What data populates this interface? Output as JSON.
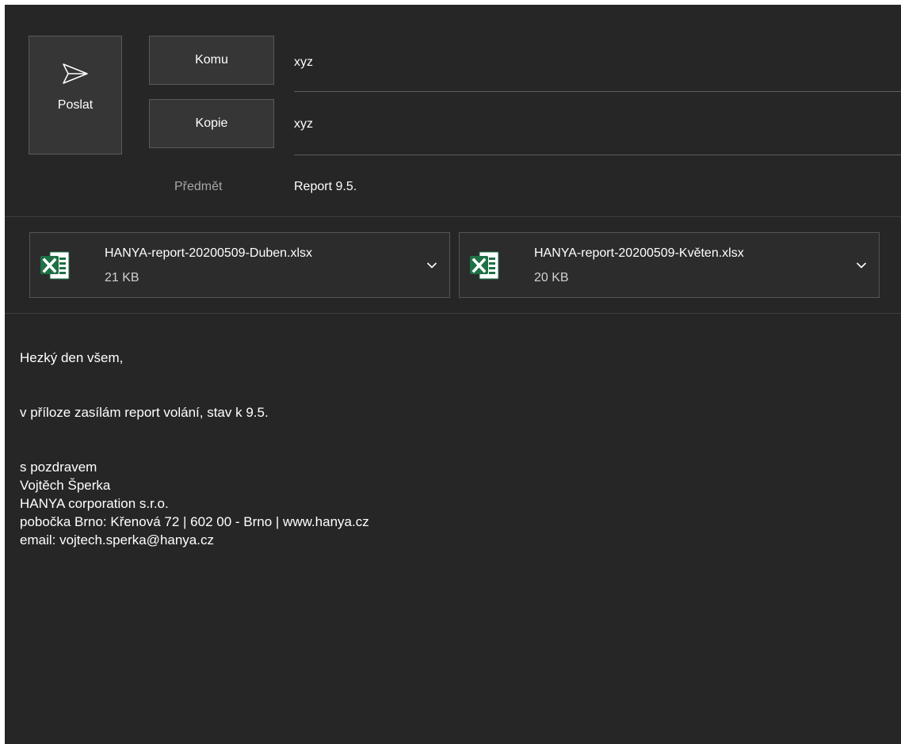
{
  "send": {
    "label": "Poslat",
    "icon": "send-icon"
  },
  "recipients": {
    "to_label": "Komu",
    "to_value": "xyz",
    "cc_label": "Kopie",
    "cc_value": "xyz"
  },
  "subject": {
    "label": "Předmět",
    "value": "Report 9.5."
  },
  "attachments": [
    {
      "name": "HANYA-report-20200509-Duben.xlsx",
      "size": "21 KB",
      "icon": "excel-file-icon"
    },
    {
      "name": "HANYA-report-20200509-Květen.xlsx",
      "size": "20 KB",
      "icon": "excel-file-icon"
    }
  ],
  "body": {
    "greeting": "Hezký den všem,",
    "message": "v příloze zasílám report volání, stav k 9.5.",
    "closing": "s pozdravem",
    "signature_name": "Vojtěch Šperka",
    "signature_company": "HANYA corporation s.r.o.",
    "signature_address": "pobočka Brno: Křenová 72 | 602 00 - Brno | www.hanya.cz",
    "signature_email": "email: vojtech.sperka@hanya.cz"
  },
  "colors": {
    "background": "#262626",
    "button_bg": "#363636",
    "button_border": "#5a5a5a",
    "excel_green": "#1e7145"
  }
}
